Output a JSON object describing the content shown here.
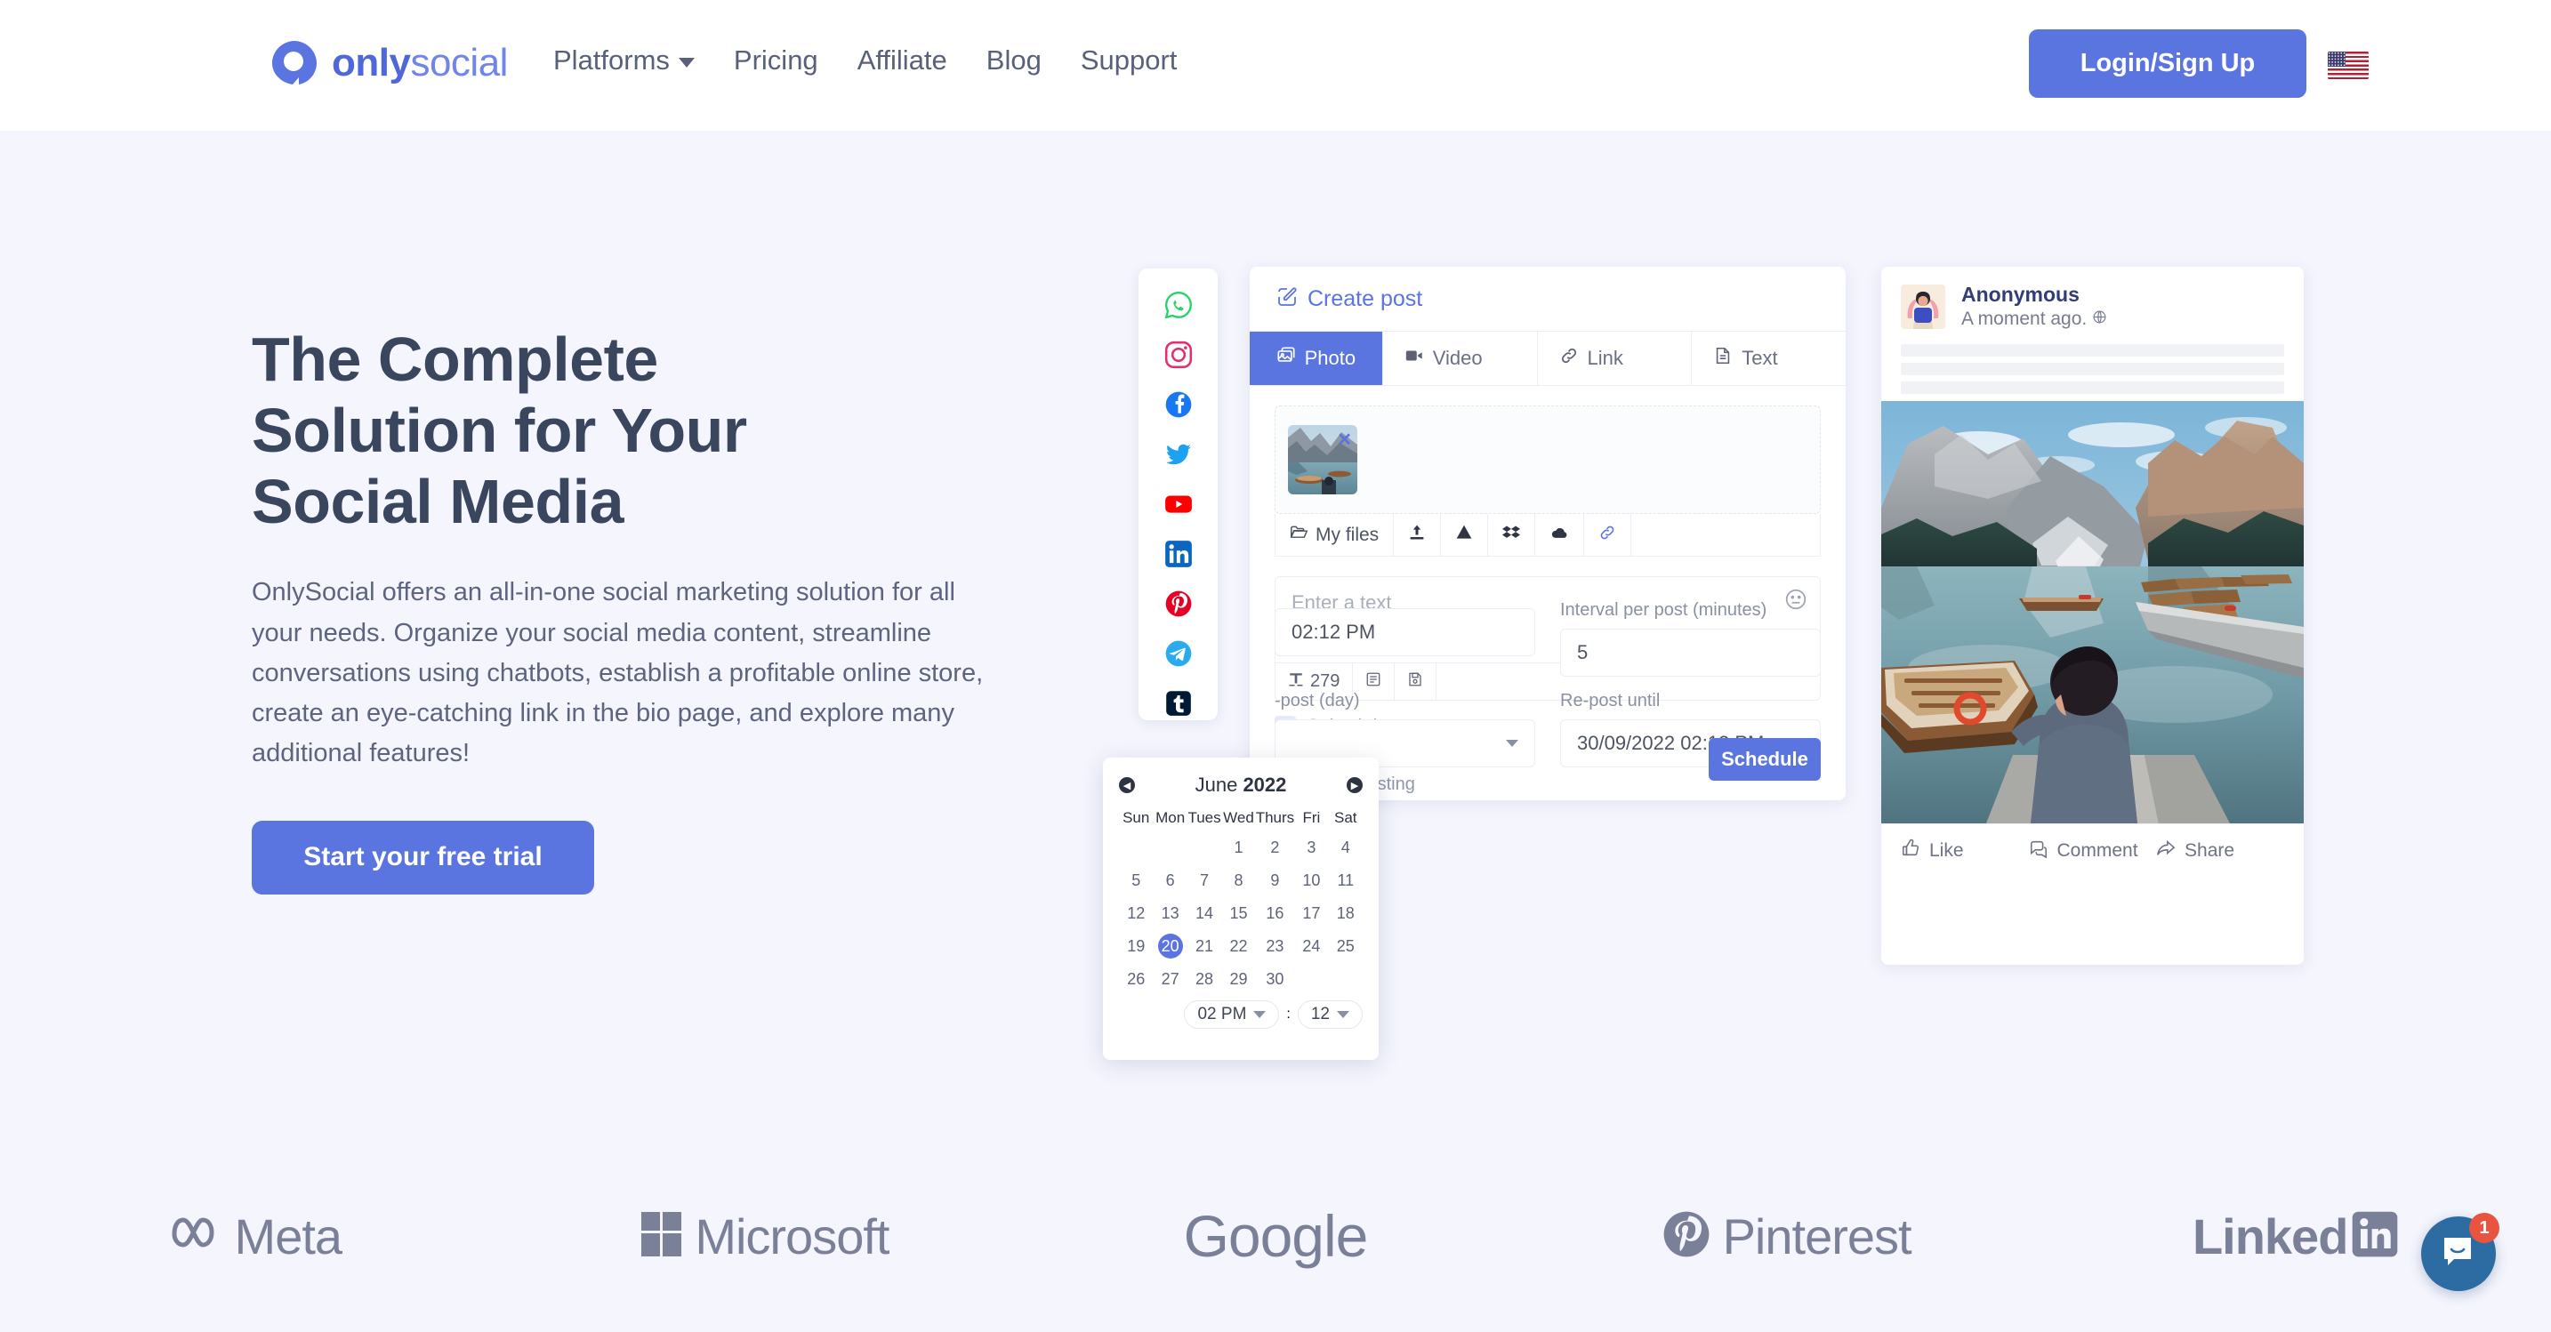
{
  "header": {
    "logo": {
      "part1": "only",
      "part2": "social",
      "icon": "onlysocial-logo-icon"
    },
    "nav": [
      {
        "label": "Platforms",
        "has_dropdown": true
      },
      {
        "label": "Pricing",
        "has_dropdown": false
      },
      {
        "label": "Affiliate",
        "has_dropdown": false
      },
      {
        "label": "Blog",
        "has_dropdown": false
      },
      {
        "label": "Support",
        "has_dropdown": false
      }
    ],
    "login_label": "Login/Sign Up",
    "flag": "us-flag-icon",
    "accent_color": "#5a74e0"
  },
  "hero": {
    "title_line1": "The Complete",
    "title_line2": "Solution for Your",
    "title_line3": "Social Media",
    "paragraph": "OnlySocial offers an all-in-one social marketing solution for all your needs. Organize your social media content, streamline conversations using chatbots, establish a profitable online store, create an eye-catching link in the bio page, and explore many additional features!",
    "cta_label": "Start your free trial",
    "title_color": "#3a465e",
    "text_color": "#5d6480"
  },
  "mockup": {
    "social_rail": [
      {
        "name": "whatsapp-icon",
        "color": "#25D366"
      },
      {
        "name": "instagram-icon",
        "color": "#E1306C"
      },
      {
        "name": "facebook-icon",
        "color": "#1877F2"
      },
      {
        "name": "twitter-icon",
        "color": "#1DA1F2"
      },
      {
        "name": "youtube-icon",
        "color": "#FF0000"
      },
      {
        "name": "linkedin-icon",
        "color": "#0A66C2"
      },
      {
        "name": "pinterest-icon",
        "color": "#E60023"
      },
      {
        "name": "telegram-icon",
        "color": "#2AABEE"
      },
      {
        "name": "tumblr-icon",
        "color": "#001935"
      }
    ],
    "post_card": {
      "header_label": "Create post",
      "tabs": [
        {
          "label": "Photo",
          "icon": "photo-icon",
          "active": true
        },
        {
          "label": "Video",
          "icon": "video-icon",
          "active": false
        },
        {
          "label": "Link",
          "icon": "link-icon",
          "active": false
        },
        {
          "label": "Text",
          "icon": "text-icon",
          "active": false
        }
      ],
      "filebar": [
        {
          "label": "My files",
          "icon": "folder-icon"
        },
        {
          "label": "",
          "icon": "upload-icon"
        },
        {
          "label": "",
          "icon": "google-drive-icon"
        },
        {
          "label": "",
          "icon": "dropbox-icon"
        },
        {
          "label": "",
          "icon": "onedrive-cloud-icon"
        },
        {
          "label": "",
          "icon": "link-chain-icon"
        }
      ],
      "textarea_placeholder": "Enter a text",
      "char_count": "279",
      "schedule_checkbox_label": "Schedule",
      "schedule_checked": true,
      "fields": [
        {
          "label": "",
          "value": "02:12 PM",
          "type": "text"
        },
        {
          "label": "Interval per post (minutes)",
          "value": "5",
          "type": "text"
        },
        {
          "label": "-post (day)",
          "value": "",
          "type": "select"
        },
        {
          "label": "Re-post until",
          "value": "30/09/2022 02:12 PM",
          "type": "text"
        }
      ],
      "hint": "disable re-posting",
      "schedule_button": "Schedule"
    },
    "calendar": {
      "month": "June ",
      "year": "2022",
      "prev": "◀",
      "next": "▶",
      "dow": [
        "Sun",
        "Mon",
        "Tues",
        "Wed",
        "Thurs",
        "Fri",
        "Sat"
      ],
      "leading_blanks": 3,
      "days": [
        1,
        2,
        3,
        4,
        5,
        6,
        7,
        8,
        9,
        10,
        11,
        12,
        13,
        14,
        15,
        16,
        17,
        18,
        19,
        20,
        21,
        22,
        23,
        24,
        25,
        26,
        27,
        28,
        29,
        30
      ],
      "selected_day": 20,
      "time_hour": "02 PM",
      "time_separator": ":",
      "time_minute": "12"
    },
    "preview": {
      "author": "Anonymous",
      "meta": "A moment ago.",
      "privacy_icon": "globe-icon",
      "actions": [
        {
          "label": "Like",
          "icon": "thumbs-up-icon"
        },
        {
          "label": "Comment",
          "icon": "comment-icon"
        },
        {
          "label": "Share",
          "icon": "share-arrow-icon"
        }
      ]
    }
  },
  "brands": [
    {
      "name": "Meta",
      "icon": "meta-infinity-icon"
    },
    {
      "name": "Microsoft",
      "icon": "microsoft-squares-icon"
    },
    {
      "name": "Google",
      "icon": "google-wordmark-icon"
    },
    {
      "name": "Pinterest",
      "icon": "pinterest-p-icon"
    },
    {
      "name": "LinkedIn",
      "icon": "linkedin-in-icon"
    }
  ],
  "chat_widget": {
    "icon": "intercom-chat-icon",
    "badge": "1",
    "color": "#2d6ca2",
    "badge_color": "#e8543f"
  }
}
